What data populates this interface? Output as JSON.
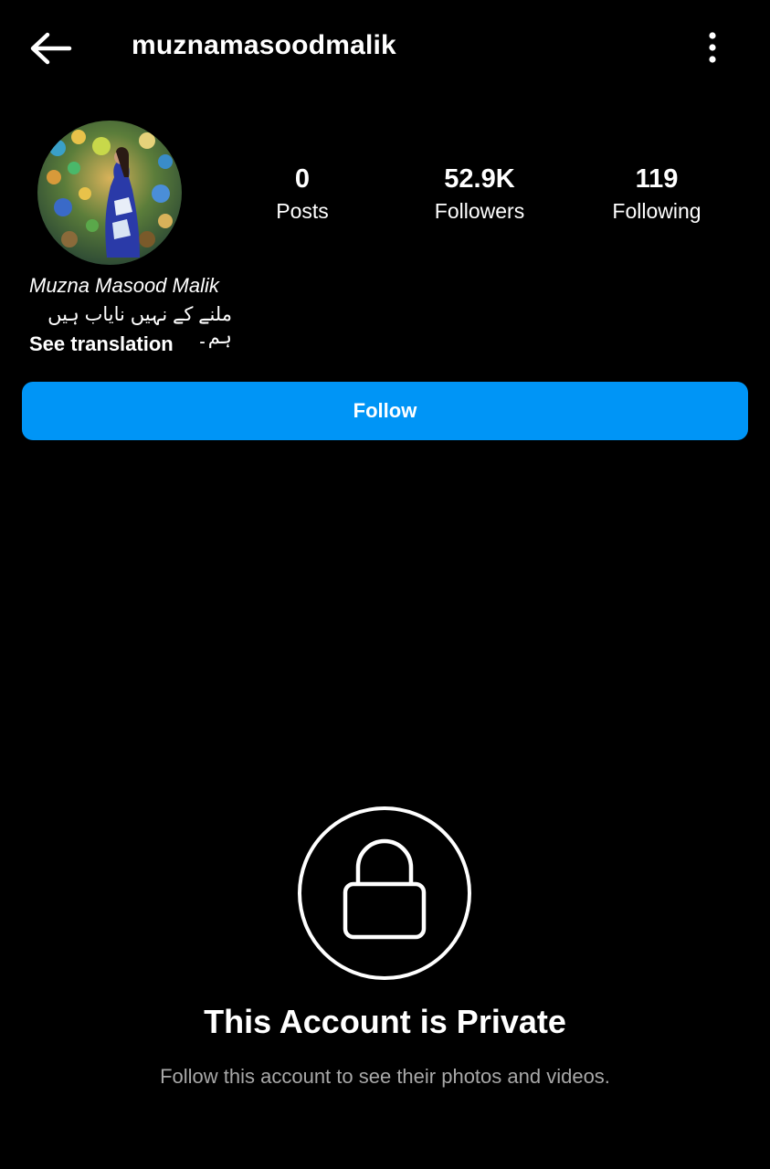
{
  "header": {
    "username": "muznamasoodmalik",
    "back_icon": "arrow-left-icon",
    "more_icon": "more-vertical-icon"
  },
  "profile": {
    "avatar": "profile-photo",
    "stats": [
      {
        "value": "0",
        "label": "Posts"
      },
      {
        "value": "52.9K",
        "label": "Followers"
      },
      {
        "value": "119",
        "label": "Following"
      }
    ],
    "display_name": "Muzna Masood Malik",
    "bio": "ملنے کے نہیں نایاب ہیں ہم۔",
    "see_translation": "See translation"
  },
  "follow_button": {
    "label": "Follow",
    "color": "#0095F6"
  },
  "private_notice": {
    "icon": "lock-icon",
    "title": "This Account is Private",
    "subtitle": "Follow this account to see their photos and videos."
  },
  "colors": {
    "background": "#000000",
    "text": "#FFFFFF",
    "secondary_text": "#A8A8A8",
    "accent": "#0095F6"
  }
}
